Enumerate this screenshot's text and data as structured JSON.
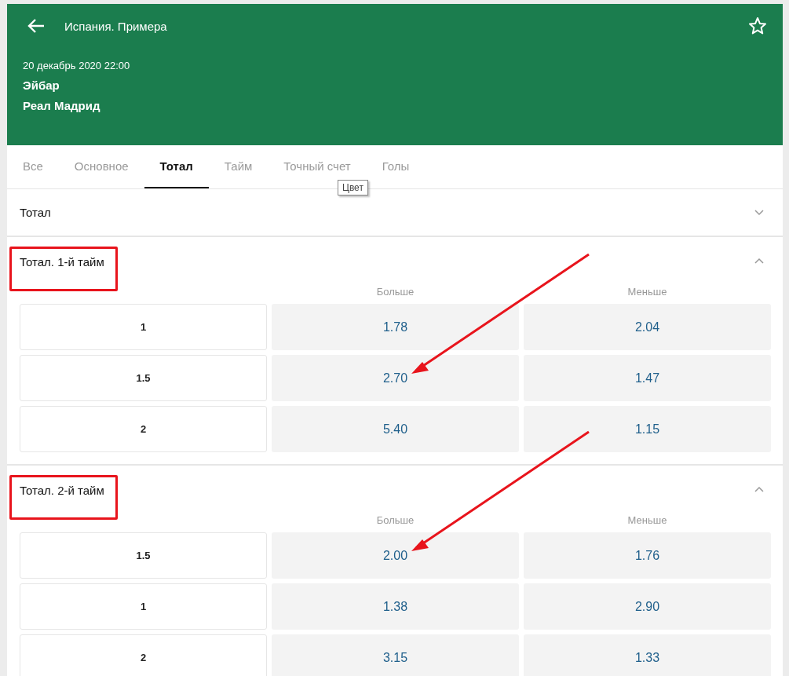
{
  "header": {
    "title": "Испания. Примера",
    "date": "20 декабрь 2020 22:00",
    "teams": [
      "Эйбар",
      "Реал Мадрид"
    ],
    "favorite": false
  },
  "tabs": [
    {
      "label": "Все",
      "selected": false
    },
    {
      "label": "Основное",
      "selected": false
    },
    {
      "label": "Тотал",
      "selected": true
    },
    {
      "label": "Тайм",
      "selected": false
    },
    {
      "label": "Точный счет",
      "selected": false
    },
    {
      "label": "Голы",
      "selected": false
    }
  ],
  "tooltip": "Цвет",
  "sections": [
    {
      "title": "Тотал",
      "expanded": false,
      "highlighted": false
    },
    {
      "title": "Тотал. 1-й тайм",
      "expanded": true,
      "highlighted": true,
      "columns": [
        "Больше",
        "Меньше"
      ],
      "rows": [
        {
          "line": "1",
          "over": "1.78",
          "under": "2.04",
          "annotated": false
        },
        {
          "line": "1.5",
          "over": "2.70",
          "under": "1.47",
          "annotated": true
        },
        {
          "line": "2",
          "over": "5.40",
          "under": "1.15",
          "annotated": false
        }
      ]
    },
    {
      "title": "Тотал. 2-й тайм",
      "expanded": true,
      "highlighted": true,
      "columns": [
        "Больше",
        "Меньше"
      ],
      "rows": [
        {
          "line": "1.5",
          "over": "2.00",
          "under": "1.76",
          "annotated": true
        },
        {
          "line": "1",
          "over": "1.38",
          "under": "2.90",
          "annotated": false
        },
        {
          "line": "2",
          "over": "3.15",
          "under": "1.33",
          "annotated": false
        }
      ]
    }
  ]
}
